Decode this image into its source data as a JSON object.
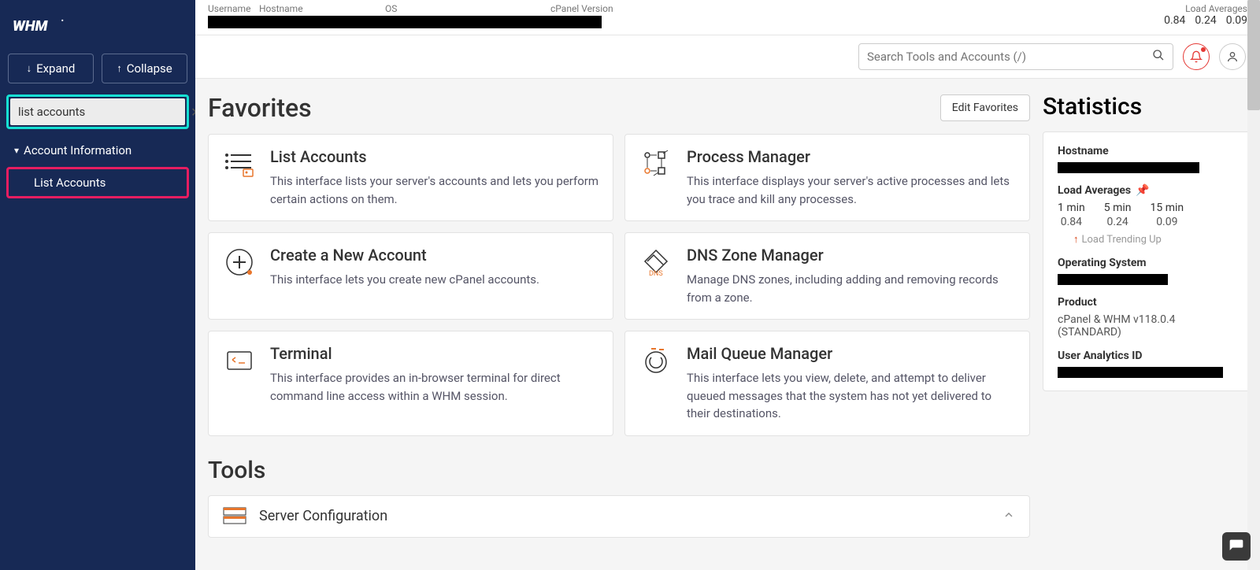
{
  "sidebar": {
    "expand_label": "Expand",
    "collapse_label": "Collapse",
    "search_value": "list accounts",
    "nav_section": "Account Information",
    "nav_item": "List Accounts"
  },
  "topinfo": {
    "col1": "Username",
    "col2": "Hostname",
    "col3": "OS",
    "col4": "cPanel Version",
    "load_label": "Load Averages",
    "v1": "0.84",
    "v2": "0.24",
    "v3": "0.09"
  },
  "toolbar": {
    "search_placeholder": "Search Tools and Accounts (/)"
  },
  "favorites": {
    "title": "Favorites",
    "edit_label": "Edit Favorites",
    "cards": [
      {
        "title": "List Accounts",
        "desc": "This interface lists your server's accounts and lets you perform certain actions on them."
      },
      {
        "title": "Process Manager",
        "desc": "This interface displays your server's active processes and lets you trace and kill any processes."
      },
      {
        "title": "Create a New Account",
        "desc": "This interface lets you create new cPanel accounts."
      },
      {
        "title": "DNS Zone Manager",
        "desc": "Manage DNS zones, including adding and removing records from a zone."
      },
      {
        "title": "Terminal",
        "desc": "This interface provides an in-browser terminal for direct command line access within a WHM session."
      },
      {
        "title": "Mail Queue Manager",
        "desc": "This interface lets you view, delete, and attempt to deliver queued messages that the system has not yet delivered to their destinations."
      }
    ]
  },
  "statistics": {
    "title": "Statistics",
    "hostname_label": "Hostname",
    "la_label": "Load Averages",
    "la_cols": [
      "1 min",
      "5 min",
      "15 min"
    ],
    "la_vals": [
      "0.84",
      "0.24",
      "0.09"
    ],
    "trend": "Load Trending Up",
    "os_label": "Operating System",
    "product_label": "Product",
    "product_value": "cPanel & WHM v118.0.4 (STANDARD)",
    "analytics_label": "User Analytics ID"
  },
  "tools": {
    "title": "Tools",
    "item": "Server Configuration"
  }
}
